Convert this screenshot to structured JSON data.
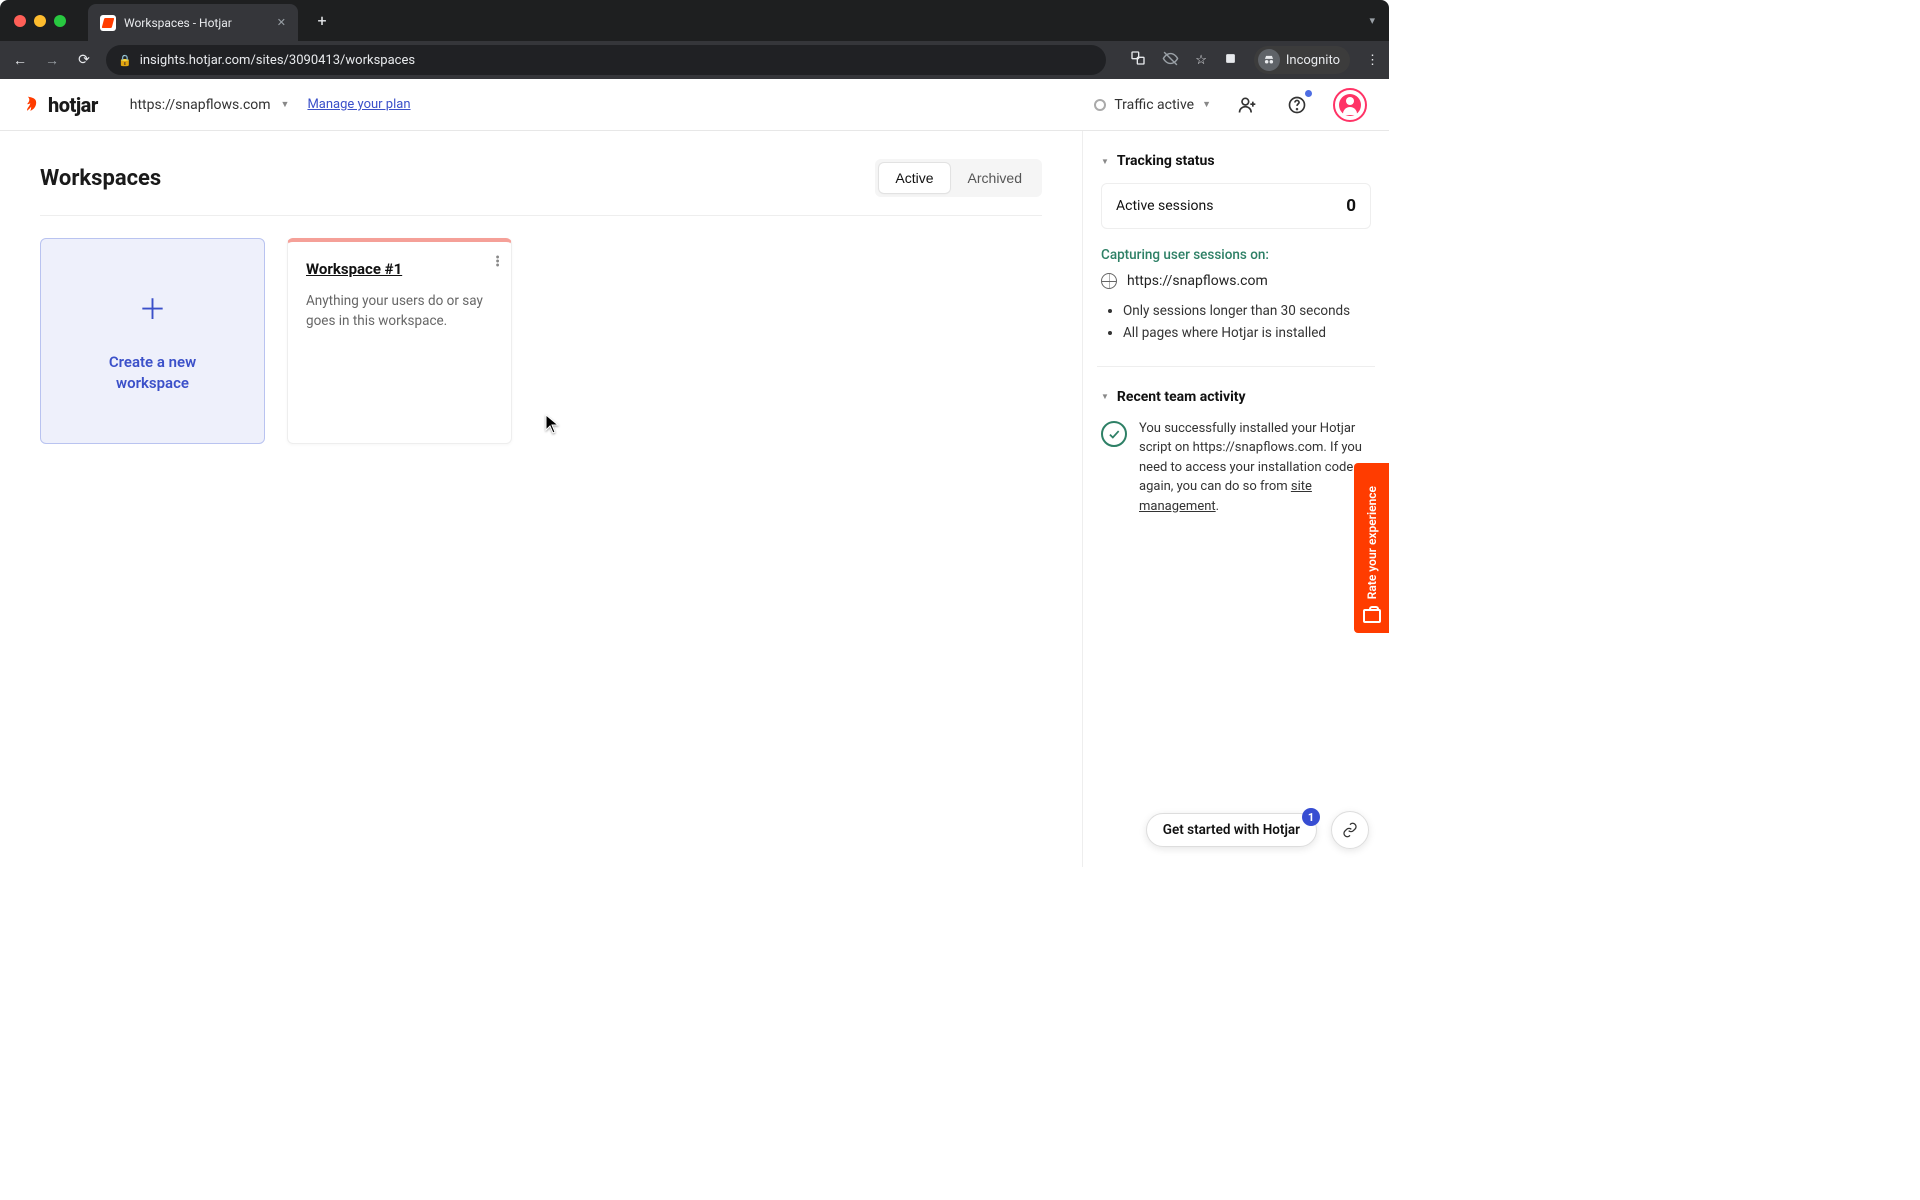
{
  "browser": {
    "tab_title": "Workspaces - Hotjar",
    "url": "insights.hotjar.com/sites/3090413/workspaces",
    "incognito_label": "Incognito"
  },
  "header": {
    "logo_text": "hotjar",
    "site_url": "https://snapflows.com",
    "manage_plan": "Manage your plan",
    "traffic_label": "Traffic active"
  },
  "main": {
    "title": "Workspaces",
    "tabs": {
      "active": "Active",
      "archived": "Archived"
    },
    "create_card": {
      "label_line1": "Create a new",
      "label_line2": "workspace"
    },
    "workspace": {
      "title": "Workspace #1",
      "desc": "Anything your users do or say goes in this workspace."
    }
  },
  "aside": {
    "tracking_heading": "Tracking status",
    "active_sessions_label": "Active sessions",
    "active_sessions_value": "0",
    "capturing_label": "Capturing user sessions on:",
    "capturing_site": "https://snapflows.com",
    "rules": [
      "Only sessions longer than 30 seconds",
      "All pages where Hotjar is installed"
    ],
    "recent_heading": "Recent team activity",
    "activity_text_pre": "You successfully installed your Hotjar script on https://snapflows.com. If you need to access your installation code again, you can do so from ",
    "activity_link": "site management",
    "activity_text_post": "."
  },
  "widgets": {
    "rate_label": "Rate your experience",
    "getstarted_label": "Get started with Hotjar",
    "getstarted_badge": "1"
  }
}
